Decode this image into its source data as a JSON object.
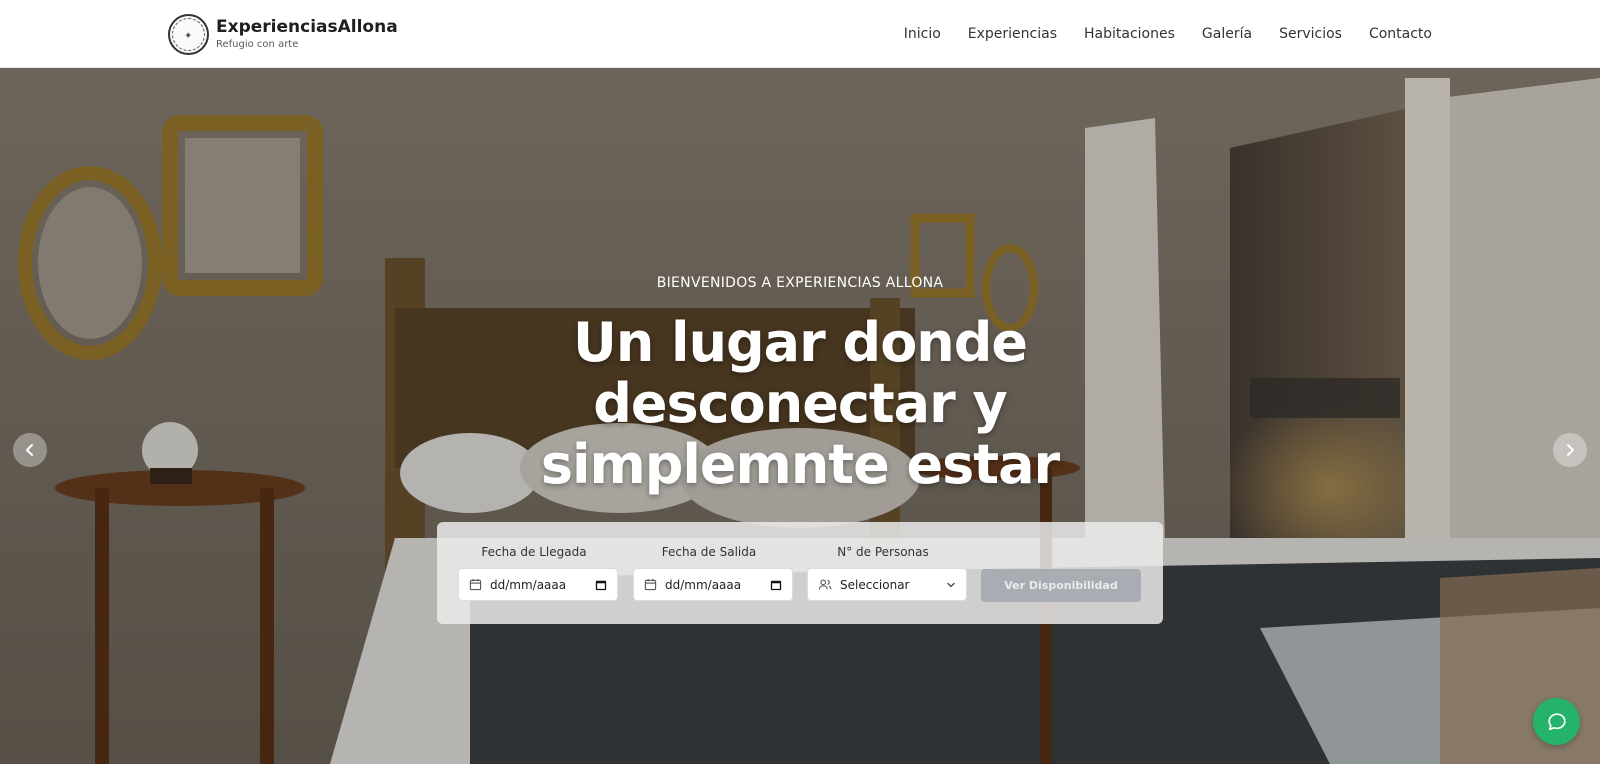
{
  "header": {
    "logo_icon": "experiencias-allona-logo",
    "brand_name": "ExperienciasAllona",
    "tagline": "Refugio con arte",
    "nav": [
      "Inicio",
      "Experiencias",
      "Habitaciones",
      "Galería",
      "Servicios",
      "Contacto"
    ]
  },
  "hero": {
    "subtitle": "BIENVENIDOS A EXPERIENCIAS ALLONA",
    "title": "Un lugar donde desconectar y simplemnte estar",
    "prev_icon": "chevron-left-icon",
    "next_icon": "chevron-right-icon"
  },
  "booking": {
    "arrival_label": "Fecha de Llegada",
    "arrival_placeholder": "dd/mm/aaaa",
    "departure_label": "Fecha de Salida",
    "departure_placeholder": "dd/mm/aaaa",
    "guests_label": "N° de Personas",
    "guests_value": "Seleccionar",
    "submit_label": "Ver Disponibilidad"
  },
  "chat": {
    "icon": "chat-bubble-icon"
  },
  "colors": {
    "chat_bg": "#25b36b",
    "submit_bg": "#a9adb3"
  }
}
